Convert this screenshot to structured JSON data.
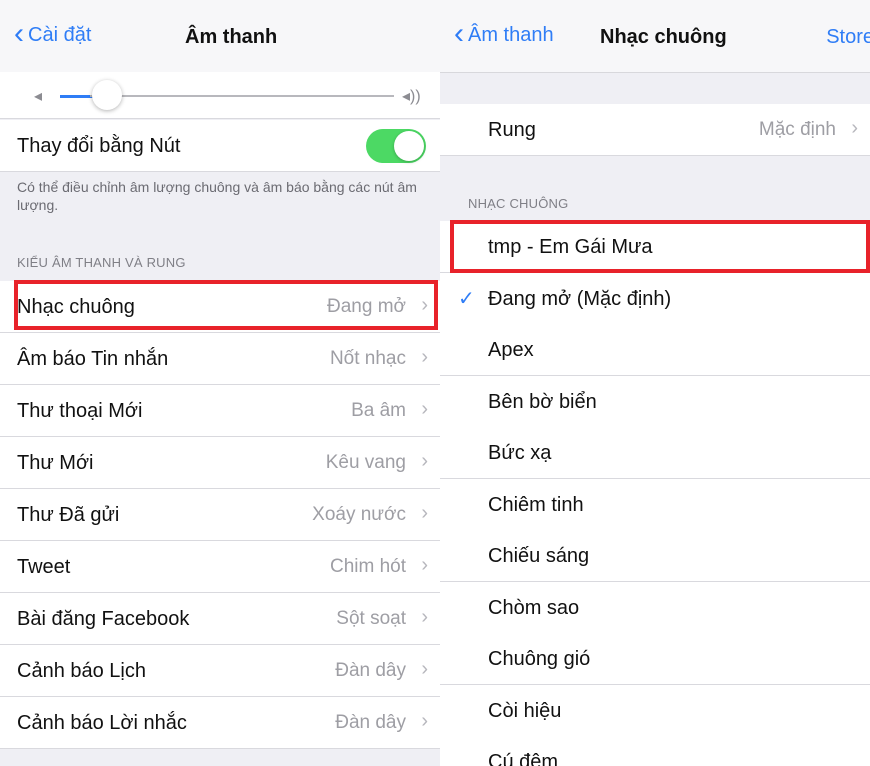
{
  "left": {
    "navbar": {
      "back_label": "Cài đặt",
      "title": "Âm thanh"
    },
    "volume": {
      "level": 0.14,
      "min_icon": "speaker-low-icon",
      "max_icon": "speaker-high-icon"
    },
    "toggle_row": {
      "label": "Thay đổi bằng Nút",
      "on": true
    },
    "footer": "Có thể điều chỉnh âm lượng chuông và âm báo bằng các nút âm lượng.",
    "section_header": "KIỂU ÂM THANH VÀ RUNG",
    "items": [
      {
        "label": "Nhạc chuông",
        "value": "Đang mở"
      },
      {
        "label": "Âm báo Tin nhắn",
        "value": "Nốt nhạc"
      },
      {
        "label": "Thư thoại Mới",
        "value": "Ba âm"
      },
      {
        "label": "Thư Mới",
        "value": "Kêu vang"
      },
      {
        "label": "Thư Đã gửi",
        "value": "Xoáy nước"
      },
      {
        "label": "Tweet",
        "value": "Chim hót"
      },
      {
        "label": "Bài đăng Facebook",
        "value": "Sột soạt"
      },
      {
        "label": "Cảnh báo Lịch",
        "value": "Đàn dây"
      },
      {
        "label": "Cảnh báo Lời nhắc",
        "value": "Đàn dây"
      }
    ]
  },
  "right": {
    "navbar": {
      "back_label": "Âm thanh",
      "title": "Nhạc chuông",
      "right_label": "Store"
    },
    "vibration": {
      "label": "Rung",
      "value": "Mặc định"
    },
    "section_header": "NHẠC CHUÔNG",
    "items": [
      {
        "label": "tmp - Em Gái Mưa"
      },
      {
        "label": "Đang mở (Mặc định)",
        "checked": true
      },
      {
        "label": "Apex"
      },
      {
        "label": "Bên bờ biển"
      },
      {
        "label": "Bức xạ"
      },
      {
        "label": "Chiêm tinh"
      },
      {
        "label": "Chiếu sáng"
      },
      {
        "label": "Chòm sao"
      },
      {
        "label": "Chuông gió"
      },
      {
        "label": "Còi hiệu"
      },
      {
        "label": "Cú đêm"
      }
    ]
  },
  "colors": {
    "accent": "#2f7df6",
    "toggle_on": "#4cd964",
    "highlight": "#e8222a"
  }
}
